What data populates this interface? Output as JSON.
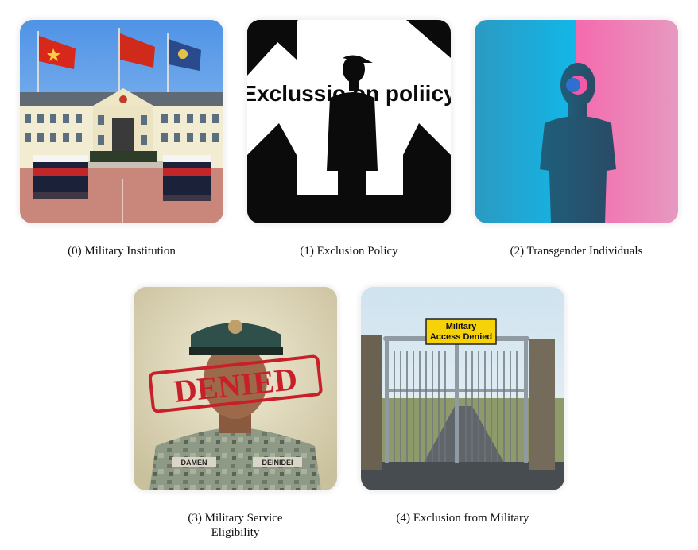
{
  "items": [
    {
      "caption": "(0) Military Institution",
      "icon": "military-building-image"
    },
    {
      "caption": "(1) Exclusion Policy",
      "icon": "exclusion-silhouette-image",
      "image_text": "Exclussio on poliicy"
    },
    {
      "caption": "(2) Transgender Individuals",
      "icon": "silhouette-gradient-image"
    },
    {
      "caption": "(3) Military Service Eligibility",
      "icon": "denied-soldier-image",
      "image_text": "DENIED",
      "name_tag_left": "DAMEN",
      "name_tag_right": "DEINIDEI"
    },
    {
      "caption": "(4) Exclusion from Military",
      "icon": "gate-sign-image",
      "sign_line1": "Military",
      "sign_line2": "Access Denied"
    }
  ],
  "colors": {
    "sky": "#5d9ee8",
    "flag_red": "#d8281c",
    "flag_blue": "#2b4a8c",
    "trans_blue": "#18a9d6",
    "trans_pink": "#f066a8",
    "stamp_red": "#c8202a",
    "sign_yellow": "#f5d20a"
  }
}
